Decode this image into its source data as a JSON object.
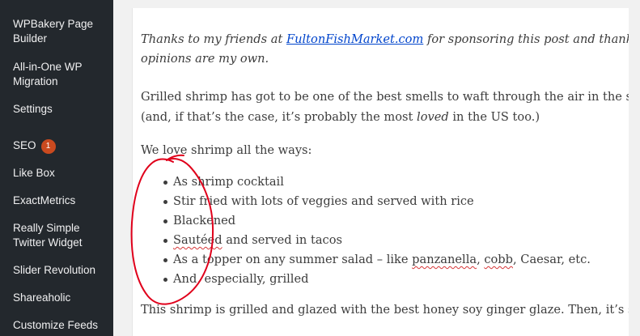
{
  "sidebar": {
    "items": [
      {
        "label": "WPBakery Page Builder"
      },
      {
        "label": "All-in-One WP Migration"
      },
      {
        "label": "Settings"
      },
      {
        "label": "SEO",
        "badge": "1"
      },
      {
        "label": "Like Box"
      },
      {
        "label": "ExactMetrics"
      },
      {
        "label": "Really Simple Twitter Widget"
      },
      {
        "label": "Slider Revolution"
      },
      {
        "label": "Shareaholic"
      },
      {
        "label": "Customize Feeds"
      }
    ]
  },
  "post": {
    "intro_before": "Thanks to my friends at ",
    "intro_link": "FultonFishMarket.com",
    "intro_after": " for sponsoring this post and thanks t",
    "intro_line2": "opinions are my own.",
    "para1_line1": "Grilled shrimp has got to be one of the best smells to waft through the air in the summ",
    "para1_line2_a": "(and, if that’s the case, it’s probably the most ",
    "para1_line2_em": "loved",
    "para1_line2_b": " in the US too.)",
    "para2": "We love shrimp all the ways:",
    "bullets": {
      "b0": "As shrimp cocktail",
      "b1": "Stir fried with lots of veggies and served with rice",
      "b2": "Blackened",
      "b3_word": "Sautéed",
      "b3_rest": " and served in tacos",
      "b4_a": "As a topper on any summer salad – like ",
      "b4_w1": "panzanella",
      "b4_sep": ", ",
      "b4_w2": "cobb",
      "b4_b": ", Caesar, etc.",
      "b5": "And, especially, grilled"
    },
    "para3": "This shrimp is grilled and glazed with the best honey soy ginger glaze. Then, it’s served"
  },
  "colors": {
    "sidebar_bg": "#23282d",
    "badge": "#ca4a1f",
    "annotation": "#e0001b",
    "link": "#0044cc"
  }
}
